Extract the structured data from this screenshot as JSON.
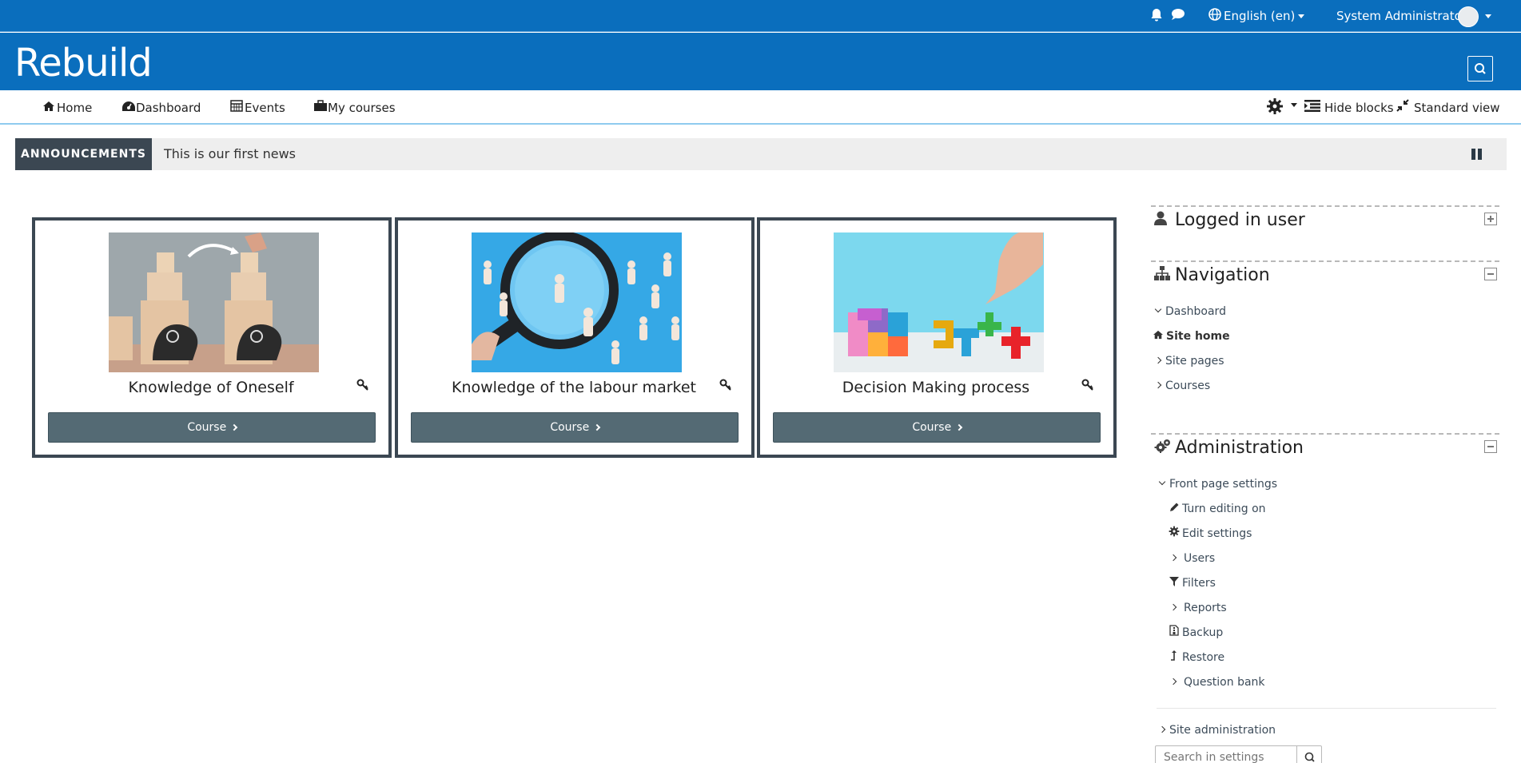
{
  "topbar": {
    "language": "English ‎(en)‎",
    "user_name": "System Administrator"
  },
  "header": {
    "site_title": "Rebuild"
  },
  "nav": {
    "home": "Home",
    "dashboard": "Dashboard",
    "events": "Events",
    "my_courses": "My courses",
    "hide_blocks": "Hide blocks",
    "standard_view": "Standard view"
  },
  "announcement": {
    "tag": "ANNOUNCEMENTS",
    "text": "This is our first news"
  },
  "courses": [
    {
      "title": "Knowledge of Oneself",
      "button": "Course"
    },
    {
      "title": "Knowledge of the labour market",
      "button": "Course"
    },
    {
      "title": "Decision Making process",
      "button": "Course"
    }
  ],
  "blocks": {
    "logged_in": {
      "title": "Logged in user"
    },
    "navigation": {
      "title": "Navigation",
      "items": [
        "Dashboard",
        "Site home",
        "Site pages",
        "Courses"
      ]
    },
    "administration": {
      "title": "Administration",
      "front_page_settings": "Front page settings",
      "items": [
        "Turn editing on",
        "Edit settings",
        "Users",
        "Filters",
        "Reports",
        "Backup",
        "Restore",
        "Question bank"
      ],
      "site_administration": "Site administration",
      "search_placeholder": "Search in settings"
    }
  },
  "colors": {
    "brand": "#0a6ebd",
    "button": "#546a74",
    "dark": "#3b4752"
  }
}
